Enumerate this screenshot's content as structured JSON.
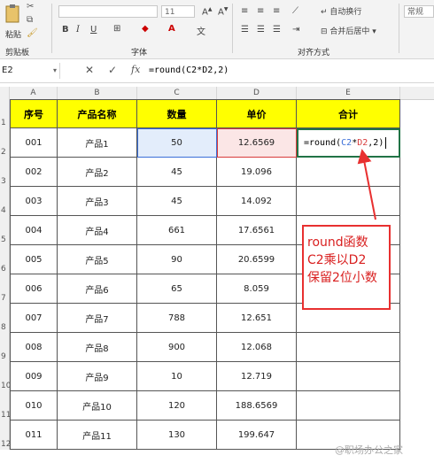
{
  "ribbon": {
    "paste_label": "粘贴",
    "clipboard_group": "剪贴板",
    "font_group": "字体",
    "align_group": "对齐方式",
    "font_size_value": "11",
    "font_name_placeholder": "",
    "wrap_text": "自动换行",
    "merge_center": "合并后居中",
    "number_format": "常规",
    "bold": "B",
    "italic": "I",
    "underline": "U"
  },
  "formula_bar": {
    "name_box": "E2",
    "cancel": "✕",
    "confirm": "✓",
    "fx": "fx",
    "formula": "=round(C2*D2,2)"
  },
  "columns": [
    "A",
    "B",
    "C",
    "D",
    "E"
  ],
  "row_numbers": [
    "1",
    "2",
    "3",
    "4",
    "5",
    "6",
    "7",
    "8",
    "9",
    "10",
    "11",
    "12"
  ],
  "table": {
    "headers": [
      "序号",
      "产品名称",
      "数量",
      "单价",
      "合计"
    ],
    "rows": [
      [
        "001",
        "产品1",
        "50",
        "12.6569",
        ""
      ],
      [
        "002",
        "产品2",
        "45",
        "19.096",
        ""
      ],
      [
        "003",
        "产品3",
        "45",
        "14.092",
        ""
      ],
      [
        "004",
        "产品4",
        "661",
        "17.6561",
        ""
      ],
      [
        "005",
        "产品5",
        "90",
        "20.6599",
        ""
      ],
      [
        "006",
        "产品6",
        "65",
        "8.059",
        ""
      ],
      [
        "007",
        "产品7",
        "788",
        "12.651",
        ""
      ],
      [
        "008",
        "产品8",
        "900",
        "12.068",
        ""
      ],
      [
        "009",
        "产品9",
        "10",
        "12.719",
        ""
      ],
      [
        "010",
        "产品10",
        "120",
        "188.6569",
        ""
      ],
      [
        "011",
        "产品11",
        "130",
        "199.647",
        ""
      ]
    ],
    "editing_cell": {
      "prefix": "=round(",
      "ref1": "C2",
      "op": "*",
      "ref2": "D2",
      "suffix": ",2)"
    }
  },
  "annotation": {
    "line1": "round函数",
    "line2": "C2乘以D2",
    "line3": "保留2位小数"
  },
  "watermark": "@职场办公之家",
  "colors": {
    "header_fill": "#ffff00",
    "ref1_color": "#3b6fd8",
    "ref2_color": "#d83b3b",
    "active_border": "#217346",
    "annotation_color": "#e83030"
  }
}
